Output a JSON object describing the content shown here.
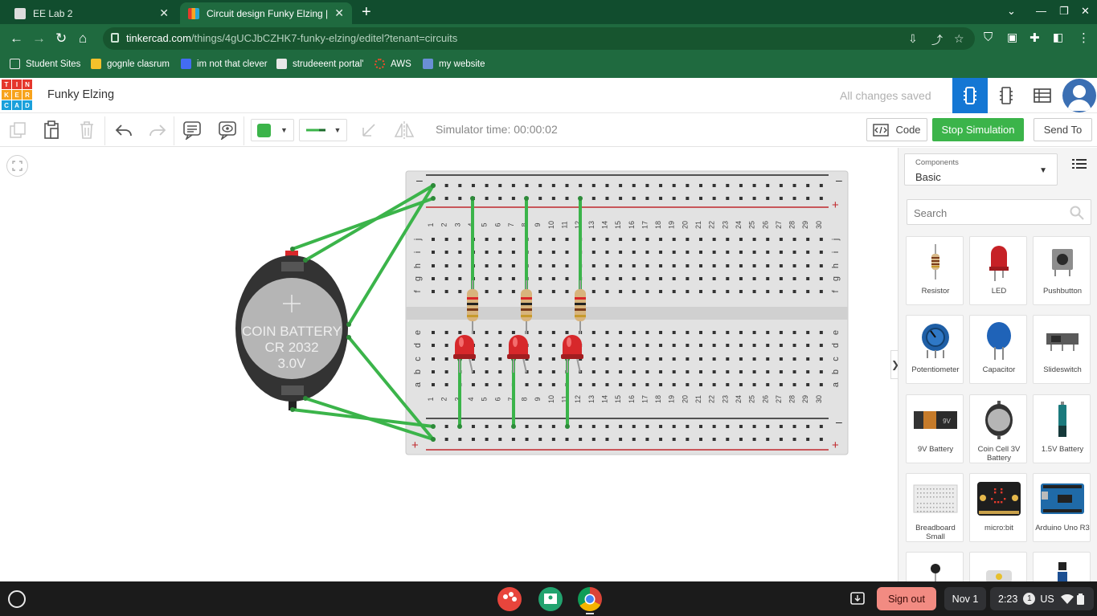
{
  "browser": {
    "tabs": [
      {
        "title": "EE Lab 2",
        "active": false
      },
      {
        "title": "Circuit design Funky Elzing | Tin",
        "active": true
      }
    ],
    "url_host": "tinkercad.com",
    "url_path": "/things/4gUCJbCZHK7-funky-elzing/editel?tenant=circuits",
    "bookmarks": [
      "Student Sites",
      "gognle clasrum",
      "im not that clever",
      "strudeeent portal'",
      "AWS",
      "my website"
    ]
  },
  "app": {
    "logo_letters": [
      "T",
      "I",
      "N",
      "K",
      "E",
      "R",
      "C",
      "A",
      "D"
    ],
    "project_title": "Funky Elzing",
    "save_status": "All changes saved"
  },
  "toolbar": {
    "simulator_time": "Simulator time: 00:00:02",
    "code_label": "Code",
    "stop_label": "Stop Simulation",
    "send_label": "Send To",
    "fill_color": "#3bb44a"
  },
  "circuit": {
    "battery": {
      "line1": "COIN BATTERY",
      "line2": "CR 2032",
      "line3": "3.0V"
    },
    "breadboard": {
      "columns": [
        "1",
        "2",
        "3",
        "4",
        "5",
        "6",
        "7",
        "8",
        "9",
        "10",
        "11",
        "12",
        "13",
        "14",
        "15",
        "16",
        "17",
        "18",
        "19",
        "20",
        "21",
        "22",
        "23",
        "24",
        "25",
        "26",
        "27",
        "28",
        "29",
        "30"
      ],
      "rows_top": [
        "j",
        "i",
        "h",
        "g",
        "f"
      ],
      "rows_bottom": [
        "e",
        "d",
        "c",
        "b",
        "a"
      ],
      "rail_minus": "–",
      "rail_plus": "+"
    },
    "wire_color": "#3bb44a",
    "led_color": "#d7282b"
  },
  "panel": {
    "category_label": "Components",
    "category_value": "Basic",
    "search_placeholder": "Search",
    "components": [
      {
        "name": "Resistor",
        "icon": "resistor-icon"
      },
      {
        "name": "LED",
        "icon": "led-icon"
      },
      {
        "name": "Pushbutton",
        "icon": "pushbutton-icon"
      },
      {
        "name": "Potentiometer",
        "icon": "potentiometer-icon"
      },
      {
        "name": "Capacitor",
        "icon": "capacitor-icon"
      },
      {
        "name": "Slideswitch",
        "icon": "slideswitch-icon"
      },
      {
        "name": "9V Battery",
        "icon": "battery-9v-icon"
      },
      {
        "name": "Coin Cell 3V Battery",
        "icon": "coin-cell-icon"
      },
      {
        "name": "1.5V Battery",
        "icon": "battery-aa-icon"
      },
      {
        "name": "Breadboard Small",
        "icon": "breadboard-icon"
      },
      {
        "name": "micro:bit",
        "icon": "microbit-icon"
      },
      {
        "name": "Arduino Uno R3",
        "icon": "arduino-icon"
      }
    ]
  },
  "shelf": {
    "sign_out": "Sign out",
    "date": "Nov 1",
    "time": "2:23",
    "notif_count": "1",
    "locale": "US"
  }
}
